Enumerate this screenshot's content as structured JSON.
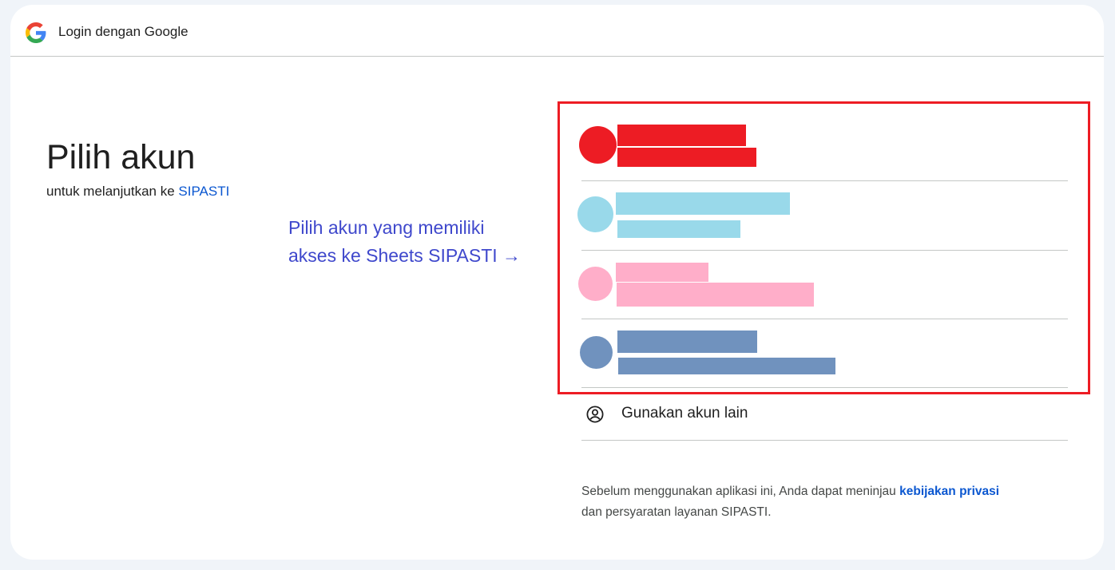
{
  "header": {
    "title": "Login dengan Google",
    "logo_icon": "google-g-icon"
  },
  "main": {
    "heading": "Pilih akun",
    "subtitle_prefix": "untuk melanjutkan ke ",
    "app_name": "SIPASTI",
    "annotation_line1": "Pilih akun yang memiliki",
    "annotation_line2": "akses ke Sheets SIPASTI →"
  },
  "accounts": [
    {
      "redacted": true,
      "color": "#ed1c24"
    },
    {
      "redacted": true,
      "color": "#99d9ea"
    },
    {
      "redacted": true,
      "color": "#ffaec9"
    },
    {
      "redacted": true,
      "color": "#7092be"
    }
  ],
  "use_other": {
    "label": "Gunakan akun lain",
    "icon": "account-circle-icon"
  },
  "footer": {
    "text_before": "Sebelum menggunakan aplikasi ini, Anda dapat meninjau ",
    "privacy_link": "kebijakan privasi",
    "text_after": "dan persyaratan layanan SIPASTI."
  },
  "colors": {
    "highlight": "#ed1c24",
    "link": "#0b57d0",
    "annotation": "#3f48cc"
  }
}
